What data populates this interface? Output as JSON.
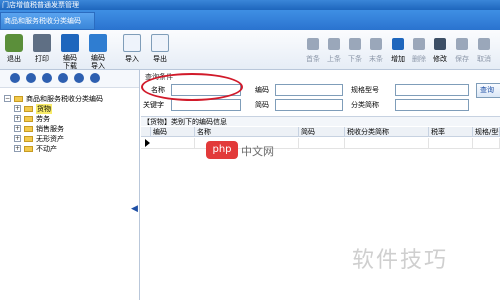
{
  "window": {
    "title": "门店增值税普通发票管理"
  },
  "tabs": [
    {
      "label": "商品和服务税收分类编码"
    }
  ],
  "toolbar": {
    "left": [
      {
        "label": "退出",
        "icon": "exit-icon"
      },
      {
        "label": "打印",
        "icon": "print-icon"
      },
      {
        "label": "编码\n下载",
        "icon": "download-icon"
      },
      {
        "label": "编码\n导入",
        "icon": "import-code-icon"
      },
      {
        "label": "导入",
        "icon": "import-icon"
      },
      {
        "label": "导出",
        "icon": "export-icon"
      }
    ],
    "right": [
      {
        "label": "首条",
        "icon": "first-icon"
      },
      {
        "label": "上条",
        "icon": "prev-icon"
      },
      {
        "label": "下条",
        "icon": "next-icon"
      },
      {
        "label": "末条",
        "icon": "last-icon"
      },
      {
        "label": "增加",
        "icon": "add-icon"
      },
      {
        "label": "删除",
        "icon": "delete-icon"
      },
      {
        "label": "修改",
        "icon": "edit-icon"
      },
      {
        "label": "保存",
        "icon": "save-icon"
      },
      {
        "label": "取消",
        "icon": "cancel-icon"
      }
    ]
  },
  "sidebar": {
    "tree_root": "商品和服务税收分类编码",
    "items": [
      {
        "label": "货物",
        "selected": true
      },
      {
        "label": "劳务",
        "selected": false
      },
      {
        "label": "销售服务",
        "selected": false
      },
      {
        "label": "无形资产",
        "selected": false
      },
      {
        "label": "不动产",
        "selected": false
      }
    ]
  },
  "query": {
    "title": "查询条件",
    "fields": {
      "name_label": "名称",
      "code_label": "编码",
      "spec_label": "规格型号",
      "keyword_label": "关键字",
      "short_code_label": "简码",
      "tax_category_label": "分类简称"
    },
    "button_label": "查询"
  },
  "grid": {
    "title": "【货物】类别下的编码信息",
    "columns": [
      "编码",
      "名称",
      "简码",
      "税收分类简称",
      "税率",
      "规格/型号"
    ]
  },
  "watermarks": {
    "php": "php",
    "php_text": "中文网",
    "bottom": "软件技巧"
  },
  "colors": {
    "titlebar": "#2a73cf",
    "oval": "#d11a2a"
  }
}
